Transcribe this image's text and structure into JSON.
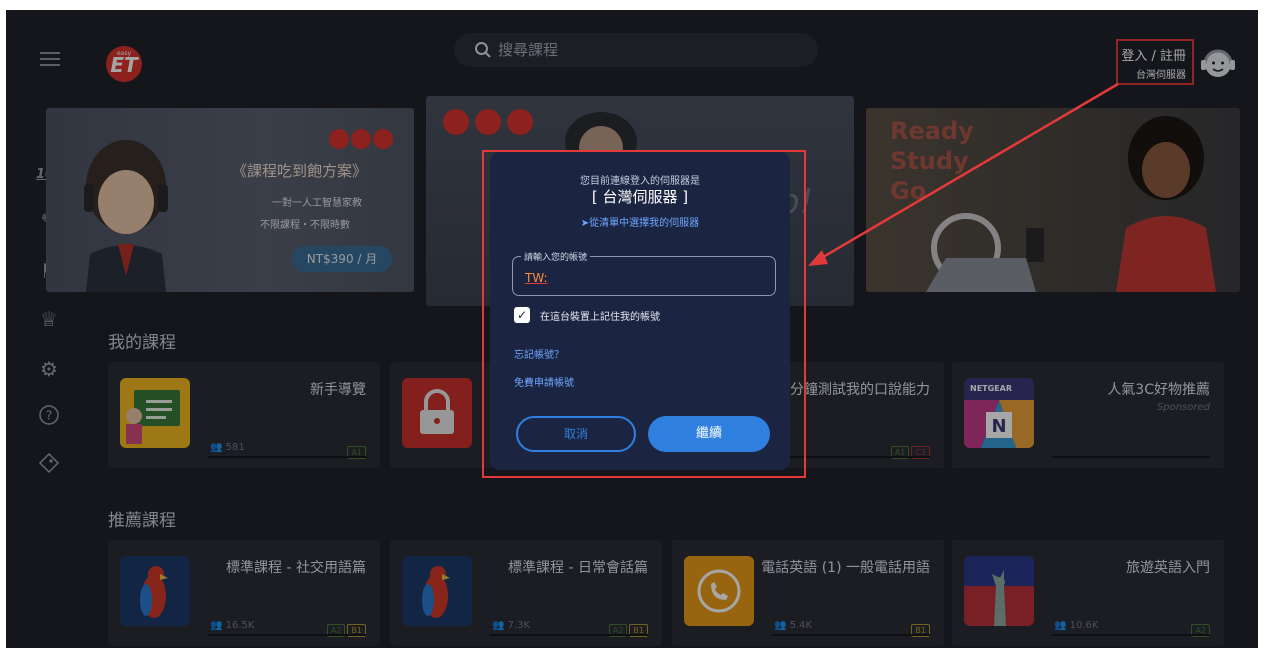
{
  "header": {
    "search_placeholder": "搜尋課程",
    "login_label": "登入 / 註冊",
    "server_label": "台灣伺服器"
  },
  "banner1": {
    "title": "《課程吃到飽方案》",
    "sub1": "一對一人工智慧家教",
    "sub2": "不限課程・不限時數",
    "price": "NT$390 / 月"
  },
  "banner3": {
    "line1": "Ready",
    "line2": "Study",
    "line3": "Go"
  },
  "banner2": {
    "partial_text": "p!"
  },
  "sections": {
    "my_courses": "我的課程",
    "recommended": "推薦課程"
  },
  "my_courses": [
    {
      "title": "新手導覽",
      "people": "581",
      "levels": [
        "A1"
      ]
    },
    {
      "title": "",
      "people": "",
      "levels": []
    },
    {
      "title": "分鐘測試我的口說能力",
      "people": "",
      "levels": [
        "A1",
        "C2"
      ]
    },
    {
      "title": "人氣3C好物推薦",
      "sponsored": "Sponsored",
      "brand": "NETGEAR",
      "people": "",
      "levels": []
    }
  ],
  "recommended_courses": [
    {
      "title": "標準課程 - 社交用語篇",
      "people": "16.5K",
      "levels": [
        "A2",
        "B1"
      ]
    },
    {
      "title": "標準課程 - 日常會話篇",
      "people": "7.3K",
      "levels": [
        "A2",
        "B1"
      ]
    },
    {
      "title": "電話英語 (1) 一般電話用語",
      "people": "5.4K",
      "levels": [
        "B1"
      ]
    },
    {
      "title": "旅遊英語入門",
      "people": "10.6K",
      "levels": [
        "A2"
      ]
    }
  ],
  "dialog": {
    "note": "您目前連線登入的伺服器是",
    "server": "[ 台灣伺服器 ]",
    "choose_link": "➤從清單中選擇我的伺服器",
    "field_label": "請輸入您的帳號",
    "field_value": "TW:",
    "remember_label": "在這台裝置上記住我的帳號",
    "remember_checked": true,
    "forgot_link": "忘記帳號？",
    "apply_link": "免費申請帳號",
    "cancel": "取消",
    "continue": "繼續"
  },
  "colors": {
    "background": "#20232b",
    "accent": "#2f80e0",
    "highlight": "#e23a3a"
  }
}
